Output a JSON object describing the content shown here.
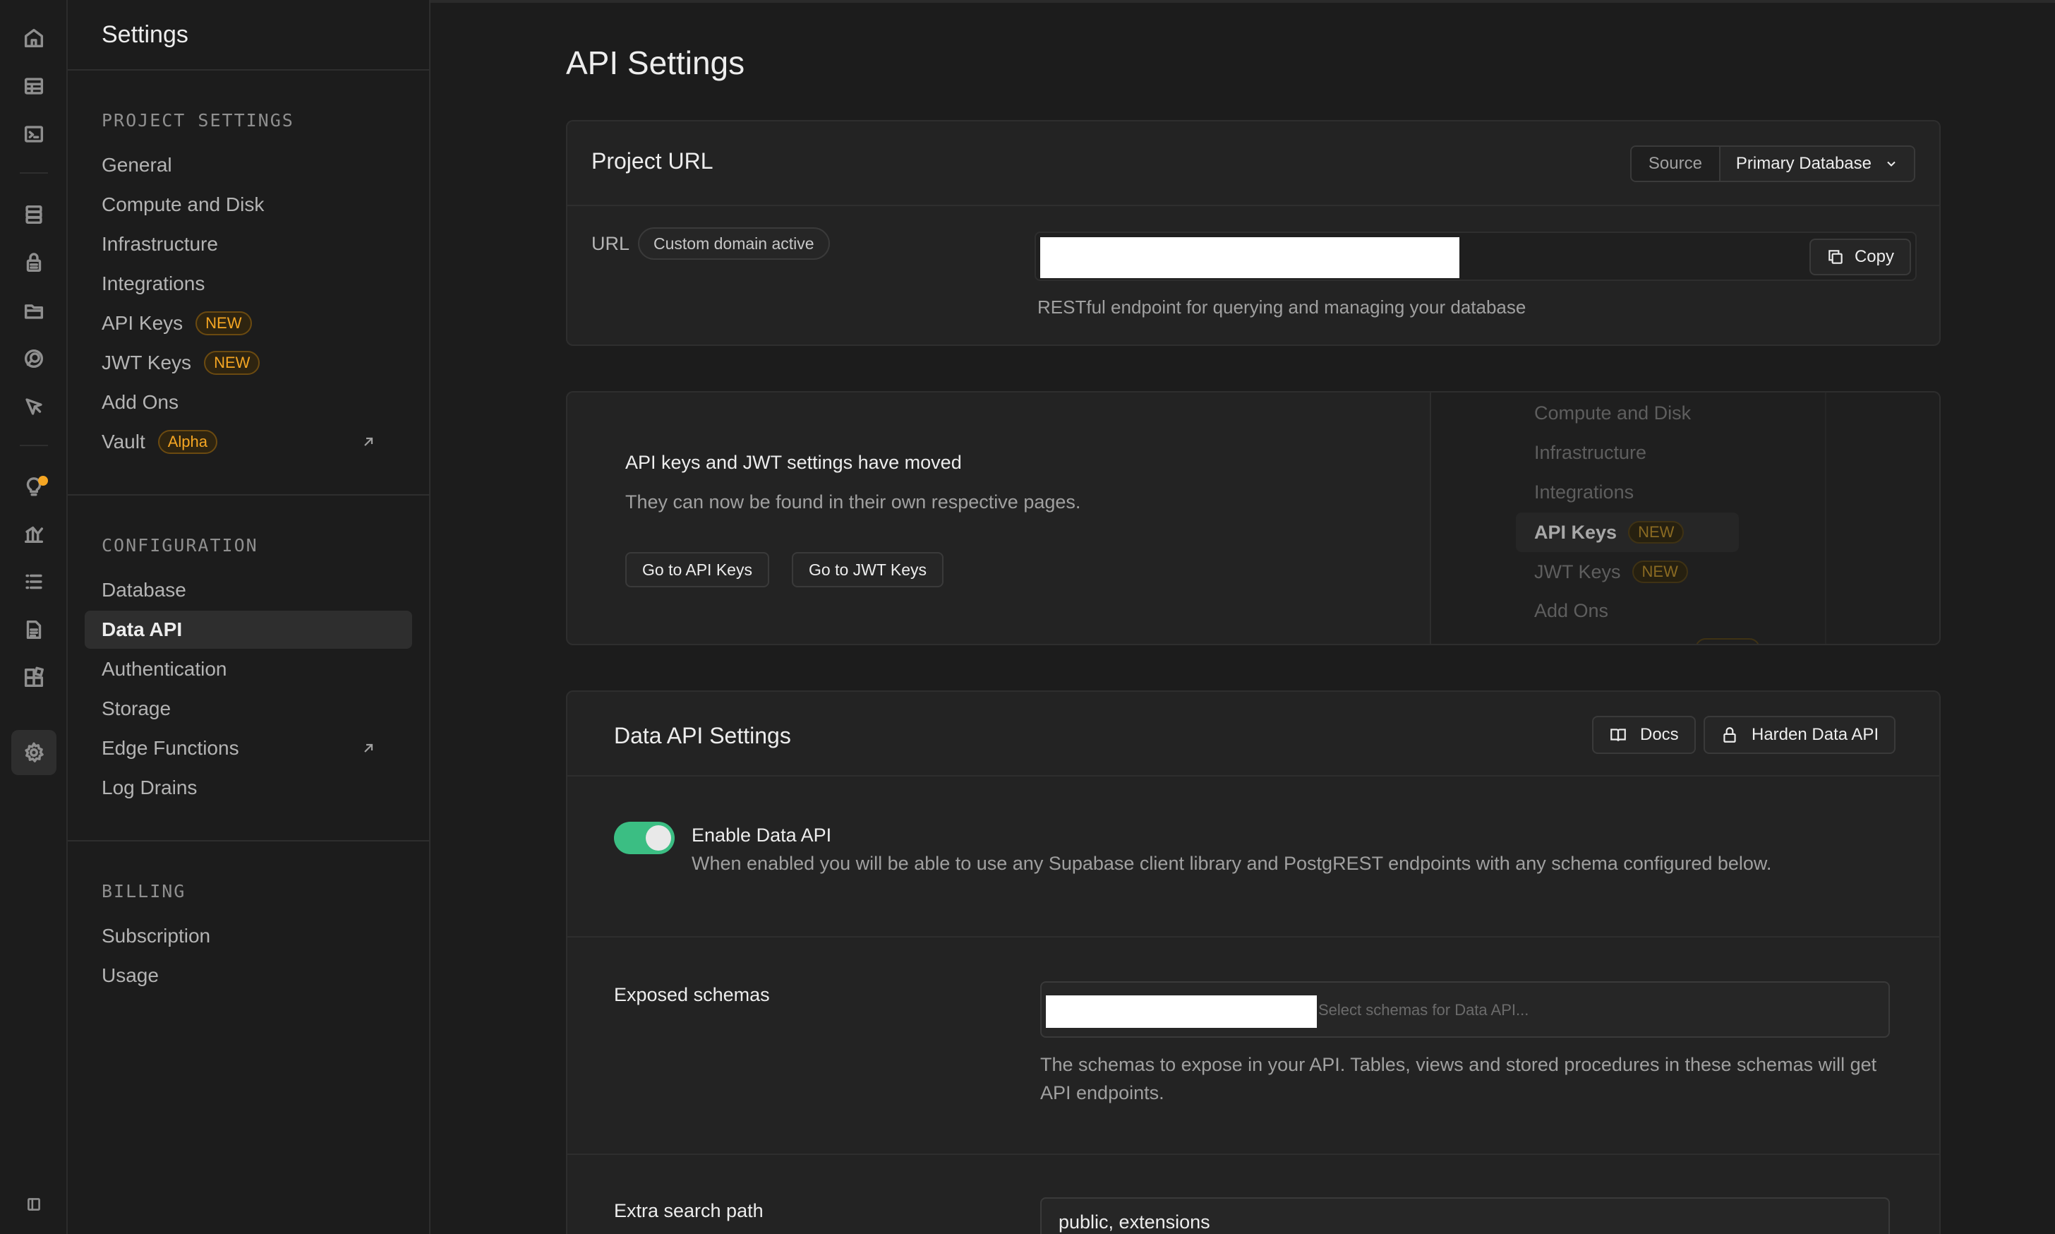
{
  "rail": {
    "icons": [
      "home-icon",
      "table-editor-icon",
      "sql-editor-icon",
      "database-icon",
      "auth-lock-icon",
      "storage-folder-icon",
      "realtime-icon",
      "edge-functions-icon",
      "advisors-bulb-icon",
      "reports-icon",
      "logs-icon",
      "api-docs-icon",
      "integrations-icon",
      "settings-gear-icon",
      "collapse-sidebar-icon"
    ]
  },
  "sidebar": {
    "title": "Settings",
    "project_settings": {
      "heading": "PROJECT SETTINGS",
      "items": [
        {
          "label": "General"
        },
        {
          "label": "Compute and Disk"
        },
        {
          "label": "Infrastructure"
        },
        {
          "label": "Integrations"
        },
        {
          "label": "API Keys",
          "badge": "NEW"
        },
        {
          "label": "JWT Keys",
          "badge": "NEW"
        },
        {
          "label": "Add Ons"
        },
        {
          "label": "Vault",
          "badge": "Alpha"
        }
      ]
    },
    "configuration": {
      "heading": "CONFIGURATION",
      "items": [
        {
          "label": "Database"
        },
        {
          "label": "Data API"
        },
        {
          "label": "Authentication"
        },
        {
          "label": "Storage"
        },
        {
          "label": "Edge Functions"
        },
        {
          "label": "Log Drains"
        }
      ]
    },
    "billing": {
      "heading": "BILLING",
      "items": [
        {
          "label": "Subscription"
        },
        {
          "label": "Usage"
        }
      ]
    }
  },
  "main": {
    "title": "API Settings",
    "project_url": {
      "title": "Project URL",
      "source_label": "Source",
      "source_value": "Primary Database",
      "url_label": "URL",
      "domain_badge": "Custom domain active",
      "copy_label": "Copy",
      "help": "RESTful endpoint for querying and managing your database"
    },
    "moved": {
      "title": "API keys and JWT settings have moved",
      "subtitle": "They can now be found in their own respective pages.",
      "go_api_keys": "Go to API Keys",
      "go_jwt_keys": "Go to JWT Keys",
      "preview_items": [
        {
          "label": "Compute and Disk"
        },
        {
          "label": "Infrastructure"
        },
        {
          "label": "Integrations"
        },
        {
          "label": "API Keys",
          "badge": "NEW"
        },
        {
          "label": "JWT Keys",
          "badge": "NEW"
        },
        {
          "label": "Add Ons"
        }
      ]
    },
    "data_api": {
      "title": "Data API Settings",
      "docs_label": "Docs",
      "harden_label": "Harden Data API",
      "enable_label": "Enable Data API",
      "enable_desc": "When enabled you will be able to use any Supabase client library and PostgREST endpoints with any schema configured below.",
      "enabled": true,
      "schemas_label": "Exposed schemas",
      "schemas_placeholder": "Select schemas for Data API...",
      "schemas_help": "The schemas to expose in your API. Tables, views and stored procedures in these schemas will get API endpoints.",
      "search_label": "Extra search path",
      "search_value": "public, extensions"
    }
  },
  "colors": {
    "background": "#1c1c1c",
    "card": "#232323",
    "border": "#2e2e2e",
    "accent_green": "#3ecf8e",
    "badge_orange": "#f5a623"
  }
}
